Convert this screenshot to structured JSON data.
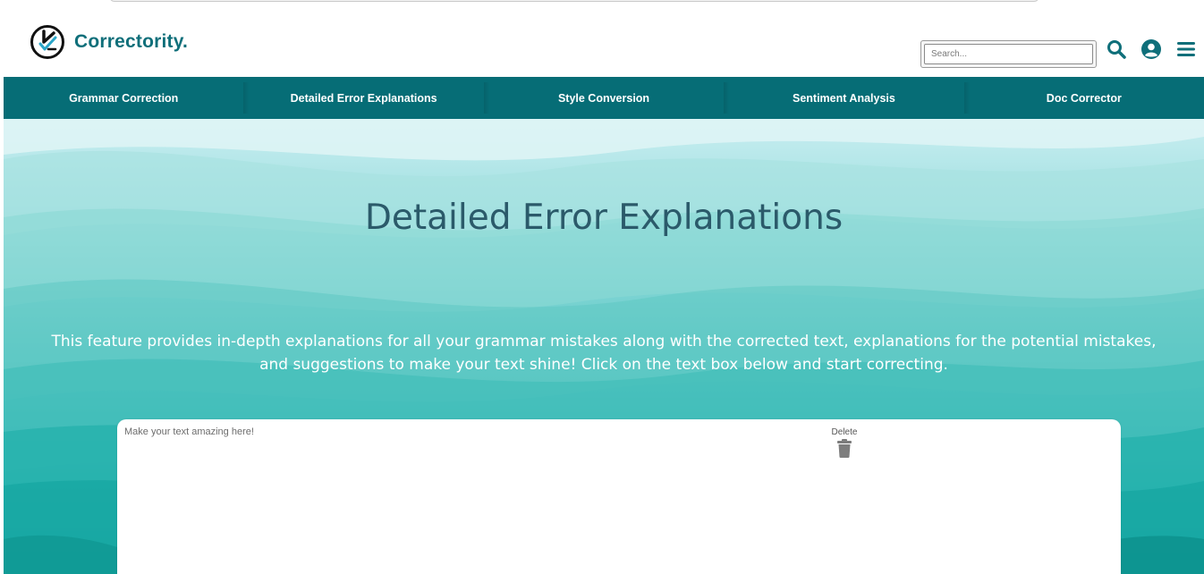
{
  "brand": {
    "name": "Correctority.",
    "color": "#0f6f7a"
  },
  "search": {
    "placeholder": "Search..."
  },
  "header_icons": [
    "search-icon",
    "account-circle-icon",
    "menu-icon"
  ],
  "nav": {
    "background": "#066d76",
    "items": [
      {
        "label": "Grammar Correction"
      },
      {
        "label": "Detailed Error Explanations"
      },
      {
        "label": "Style Conversion"
      },
      {
        "label": "Sentiment Analysis"
      },
      {
        "label": "Doc Corrector"
      }
    ]
  },
  "hero": {
    "title": "Detailed Error Explanations",
    "description": "This feature provides in-depth explanations for all your grammar mistakes along with the corrected text, explanations for the potential mistakes, and suggestions to make your text shine! Click on the text box below and start correcting."
  },
  "editor": {
    "placeholder": "Make your text amazing here!",
    "delete_label": "Delete"
  }
}
